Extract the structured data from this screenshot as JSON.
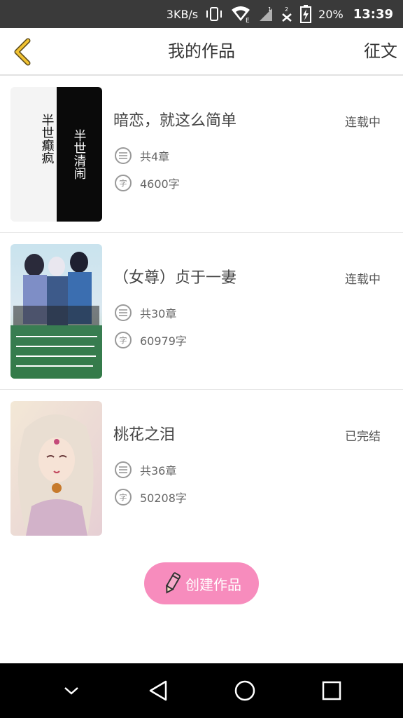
{
  "status_bar": {
    "speed": "3KB/s",
    "battery": "20%",
    "time": "13:39",
    "icons": [
      "vibrate-icon",
      "wifi-icon",
      "signal-icon",
      "no-signal-icon",
      "battery-icon"
    ]
  },
  "header": {
    "title": "我的作品",
    "right_link": "征文"
  },
  "works": [
    {
      "title": "暗恋，就这么简单",
      "status": "连载中",
      "chapters": "共4章",
      "words": "4600字",
      "cover_text_left": "半世癫疯",
      "cover_text_right": "半世清闹"
    },
    {
      "title": "（女尊）贞于一妻",
      "status": "连载中",
      "chapters": "共30章",
      "words": "60979字"
    },
    {
      "title": "桃花之泪",
      "status": "已完结",
      "chapters": "共36章",
      "words": "50208字"
    }
  ],
  "meta_icon_word_char": "字",
  "create_button_label": "创建作品",
  "colors": {
    "accent_pink": "#f78cbd",
    "back_arrow": "#f1c232",
    "status_bar": "#3a3a3a",
    "nav_bar": "#000000"
  }
}
